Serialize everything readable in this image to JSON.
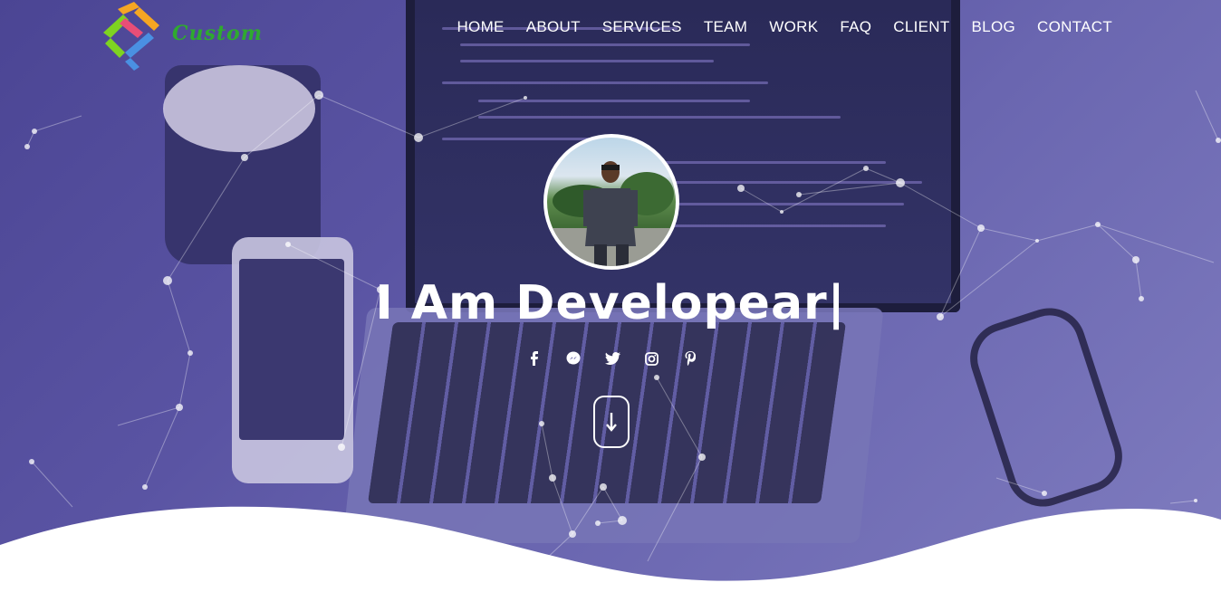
{
  "brand": {
    "name": "Custom",
    "colors": [
      "#f5a623",
      "#7ed321",
      "#4a90e2",
      "#e94e77"
    ]
  },
  "nav": {
    "items": [
      {
        "label": "HOME"
      },
      {
        "label": "ABOUT"
      },
      {
        "label": "SERVICES"
      },
      {
        "label": "TEAM"
      },
      {
        "label": "WORK"
      },
      {
        "label": "FAQ"
      },
      {
        "label": "CLIENT"
      },
      {
        "label": "BLOG"
      },
      {
        "label": "CONTACT"
      }
    ]
  },
  "hero": {
    "headline": "I Am Developear|",
    "social": [
      {
        "icon": "facebook-icon"
      },
      {
        "icon": "messenger-icon"
      },
      {
        "icon": "twitter-icon"
      },
      {
        "icon": "instagram-icon"
      },
      {
        "icon": "pinterest-icon"
      }
    ],
    "scroll_icon": "arrow-down-icon",
    "overlay_color": "#4b4594"
  }
}
